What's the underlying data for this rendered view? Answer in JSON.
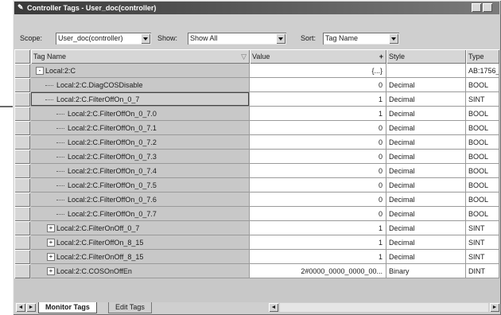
{
  "window": {
    "title": "Controller Tags - User_doc(controller)"
  },
  "toolbar": {
    "scope_label": "Scope:",
    "scope_value": "User_doc(controller)",
    "show_label": "Show:",
    "show_value": "Show All",
    "sort_label": "Sort:",
    "sort_value": "Tag Name"
  },
  "columns": {
    "tag_name": "Tag Name",
    "value": "Value",
    "style": "Style",
    "type": "Type"
  },
  "rows": [
    {
      "name": "Local:2:C",
      "value": "{...}",
      "style": "",
      "type": "AB:1756_",
      "expander": "-"
    },
    {
      "name": "Local:2:C.DiagCOSDisable",
      "value": "0",
      "style": "Decimal",
      "type": "BOOL",
      "expander": ""
    },
    {
      "name": "Local:2:C.FilterOffOn_0_7",
      "value": "1",
      "style": "Decimal",
      "type": "SINT",
      "expander": ""
    },
    {
      "name": "Local:2:C.FilterOffOn_0_7.0",
      "value": "1",
      "style": "Decimal",
      "type": "BOOL",
      "expander": ""
    },
    {
      "name": "Local:2:C.FilterOffOn_0_7.1",
      "value": "0",
      "style": "Decimal",
      "type": "BOOL",
      "expander": ""
    },
    {
      "name": "Local:2:C.FilterOffOn_0_7.2",
      "value": "0",
      "style": "Decimal",
      "type": "BOOL",
      "expander": ""
    },
    {
      "name": "Local:2:C.FilterOffOn_0_7.3",
      "value": "0",
      "style": "Decimal",
      "type": "BOOL",
      "expander": ""
    },
    {
      "name": "Local:2:C.FilterOffOn_0_7.4",
      "value": "0",
      "style": "Decimal",
      "type": "BOOL",
      "expander": ""
    },
    {
      "name": "Local:2:C.FilterOffOn_0_7.5",
      "value": "0",
      "style": "Decimal",
      "type": "BOOL",
      "expander": ""
    },
    {
      "name": "Local:2:C.FilterOffOn_0_7.6",
      "value": "0",
      "style": "Decimal",
      "type": "BOOL",
      "expander": ""
    },
    {
      "name": "Local:2:C.FilterOffOn_0_7.7",
      "value": "0",
      "style": "Decimal",
      "type": "BOOL",
      "expander": ""
    },
    {
      "name": "Local:2:C.FilterOnOff_0_7",
      "value": "1",
      "style": "Decimal",
      "type": "SINT",
      "expander": "+"
    },
    {
      "name": "Local:2:C.FilterOffOn_8_15",
      "value": "1",
      "style": "Decimal",
      "type": "SINT",
      "expander": "+"
    },
    {
      "name": "Local:2:C.FilterOnOff_8_15",
      "value": "1",
      "style": "Decimal",
      "type": "SINT",
      "expander": "+"
    },
    {
      "name": "Local:2:C.COSOnOffEn",
      "value": "2#0000_0000_0000_00...",
      "style": "Binary",
      "type": "DINT",
      "expander": "+"
    }
  ],
  "tabs": {
    "monitor": "Monitor Tags",
    "edit": "Edit Tags"
  },
  "colors": {
    "title_bg": "#3a3a3a",
    "grid_bg": "#c8c8c8",
    "cell_bg": "#ffffff"
  }
}
